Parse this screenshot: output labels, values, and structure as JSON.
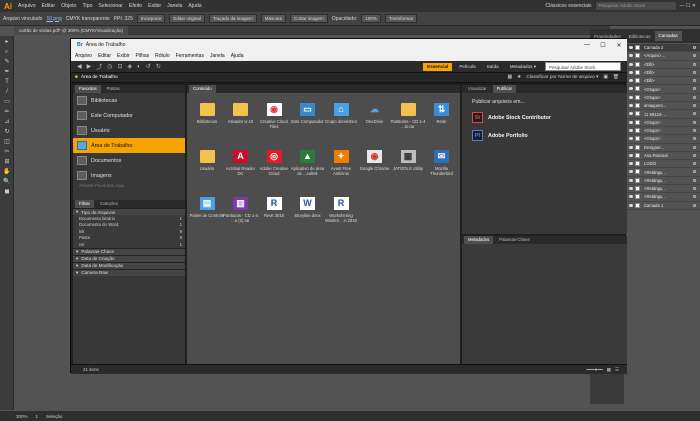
{
  "ai": {
    "logo": "Ai",
    "menu": [
      "Arquivo",
      "Editar",
      "Objeto",
      "Tipo",
      "Selecionar",
      "Efeito",
      "Exibir",
      "Janela",
      "Ajuda"
    ],
    "workspace": "Clássicos essenciais",
    "search_placeholder": "Pesquisar Adobe Stock",
    "control": {
      "selection": "Arquivo vinculado",
      "file": "10.png",
      "color": "CMYK transparente",
      "ppi": "PPI: 325",
      "embed": "Incorporar",
      "edit": "Editar original",
      "trace": "Traçado da imagem",
      "mask": "Máscara",
      "crop": "Cortar imagem",
      "opacity_label": "Opacidade:",
      "opacity": "100%",
      "transform": "Transformar"
    },
    "doc_tab": "cartão de visitas.pdf* @ 300% (CMYK/Visualização)",
    "tools": [
      "▸",
      "▹",
      "✎",
      "✒",
      "T",
      "/",
      "▭",
      "✏",
      "⊿",
      "↻",
      "◫",
      "✂",
      "⊞",
      "✋",
      "🔍",
      "◼"
    ],
    "status": {
      "zoom": "300%",
      "page": "1",
      "mode": "Seleção"
    }
  },
  "panels": {
    "tabs": [
      "Propriedades",
      "Bibliotecas",
      "Camadas"
    ],
    "active": "Camadas"
  },
  "layers": [
    {
      "name": "Camada 2",
      "selected": true
    },
    {
      "name": "<Arquivo ..."
    },
    {
      "name": "<Elli>"
    },
    {
      "name": "<Elli>"
    },
    {
      "name": "<Elli>"
    },
    {
      "name": "<Grupo>"
    },
    {
      "name": "<Grupo>"
    },
    {
      "name": "amaquero..."
    },
    {
      "name": "11 98123-..."
    },
    {
      "name": "<Grupo>"
    },
    {
      "name": "<Grupo>"
    },
    {
      "name": "<Grupo>"
    },
    {
      "name": "Designer..."
    },
    {
      "name": "Ana Pascoal"
    },
    {
      "name": "LOGO"
    },
    {
      "name": "<Retângu..."
    },
    {
      "name": "<Retângu..."
    },
    {
      "name": "<Retângu..."
    },
    {
      "name": "<Retângu..."
    },
    {
      "name": "Camada 1"
    }
  ],
  "layers_footer": "2 Camadas",
  "bridge": {
    "title": "Área de Trabalho",
    "menu": [
      "Arquivo",
      "Editar",
      "Exibir",
      "Pilhas",
      "Rótulo",
      "Ferramentas",
      "Janela",
      "Ajuda"
    ],
    "workspaces": [
      "Essencial",
      "Película",
      "Saída",
      "Metadados ▾"
    ],
    "active_workspace": "Essencial",
    "search_placeholder": "Pesquisar Adobe Stock",
    "path": "Área de Trabalho",
    "sort": "Classificar por Nome de arquivo ▾",
    "left_tabs": [
      "Favoritos",
      "Pastas"
    ],
    "favorites": [
      {
        "label": "Bibliotecas"
      },
      {
        "label": "Este Computador"
      },
      {
        "label": "Usuário"
      },
      {
        "label": "Área de Trabalho",
        "selected": true
      },
      {
        "label": "Documentos"
      },
      {
        "label": "Imagens"
      }
    ],
    "fav_hint": "Arraste Favoritos Aqui...",
    "filter_tabs": [
      "Filtrar",
      "Coleções"
    ],
    "filter_sections": [
      {
        "title": "Tipo de Arquivos",
        "items": [
          {
            "name": "Documento binário",
            "count": "1"
          },
          {
            "name": "Documento do Word",
            "count": "1"
          },
          {
            "name": "lnk",
            "count": "9"
          },
          {
            "name": "Pasta",
            "count": "9"
          },
          {
            "name": "rar",
            "count": "1"
          }
        ]
      },
      {
        "title": "Palavras-Chave",
        "items": []
      },
      {
        "title": "Data de Criação",
        "items": []
      },
      {
        "title": "Data de Modificação",
        "items": []
      },
      {
        "title": "Camera Raw",
        "items": []
      }
    ],
    "content_tab": "Conteúdo",
    "items": [
      {
        "name": "Bibliotecas",
        "icon": "folder",
        "glyph": ""
      },
      {
        "name": "Ativador w 10",
        "icon": "folder",
        "glyph": ""
      },
      {
        "name": "Creative Cloud Files",
        "icon": "cc",
        "glyph": "◉",
        "bg": "#ffffff",
        "fg": "#e03a3a"
      },
      {
        "name": "Este Computador",
        "icon": "pc",
        "glyph": "▭",
        "bg": "#3a86d0",
        "fg": "#ffffff"
      },
      {
        "name": "Grupo doméstico",
        "icon": "home",
        "glyph": "⌂",
        "bg": "#4a9fe0",
        "fg": "#ffffff"
      },
      {
        "name": "OneDrive",
        "icon": "cloud",
        "glyph": "☁",
        "bg": "#4d4d4d",
        "fg": "#4ca4ff"
      },
      {
        "name": "Partituras - CD 1-4 ...to.rar",
        "icon": "folder",
        "glyph": ""
      },
      {
        "name": "Rede",
        "icon": "net",
        "glyph": "⇅",
        "bg": "#3d8ed8",
        "fg": "#ffffff"
      },
      {
        "name": "Usuário",
        "icon": "folder",
        "glyph": ""
      },
      {
        "name": "Acrobat Reader DC",
        "icon": "acro",
        "glyph": "A",
        "bg": "#c8102e",
        "fg": "#ffffff"
      },
      {
        "name": "Adobe Creative Cloud",
        "icon": "cc2",
        "glyph": "◎",
        "bg": "#da1f26",
        "fg": "#ffffff"
      },
      {
        "name": "Aplicativo de área de ...ealtek",
        "icon": "rt",
        "glyph": "▲",
        "bg": "#2c7a3c",
        "fg": "#ffffff"
      },
      {
        "name": "Avast Free Antivirus",
        "icon": "av",
        "glyph": "✦",
        "bg": "#f07d00",
        "fg": "#ffffff"
      },
      {
        "name": "Google Chrome",
        "icon": "gc",
        "glyph": "◉",
        "bg": "#e8e8e8",
        "fg": "#d93025"
      },
      {
        "name": "JATOOLS Utility",
        "icon": "jt",
        "glyph": "▦",
        "bg": "#bdbdbd",
        "fg": "#333333"
      },
      {
        "name": "Mozilla Thunderbird",
        "icon": "tb",
        "glyph": "✉",
        "bg": "#2f6db8",
        "fg": "#ffffff"
      },
      {
        "name": "Painel de Controle",
        "icon": "cp",
        "glyph": "▤",
        "bg": "#4c9fe2",
        "fg": "#ffffff"
      },
      {
        "name": "Partituras - CD 1-4 ...o (2).rar",
        "icon": "rar",
        "glyph": "▥",
        "bg": "#7a3aa8",
        "fg": "#ffffff"
      },
      {
        "name": "Revit 2018",
        "icon": "rv",
        "glyph": "R",
        "bg": "#ffffff",
        "fg": "#1e4f9a"
      },
      {
        "name": "Storyline.docx",
        "icon": "doc",
        "glyph": "W",
        "bg": "#ffffff",
        "fg": "#2b5797"
      },
      {
        "name": "Workshering Monitor ...A 2018",
        "icon": "rv2",
        "glyph": "R",
        "bg": "#ffffff",
        "fg": "#1e4f9a"
      }
    ],
    "preview_tabs": [
      "Visualizar",
      "Publicar"
    ],
    "publish_text": "Publicar arquivos em...",
    "services": [
      {
        "badge": "St",
        "label": "Adobe Stock Contributor",
        "color": "#e0414b"
      },
      {
        "badge": "Pf",
        "label": "Adobe Portfolio",
        "color": "#4b7fe0"
      }
    ],
    "meta_tabs": [
      "Metadados",
      "Palavras-Chave"
    ],
    "status": "21 itens"
  }
}
